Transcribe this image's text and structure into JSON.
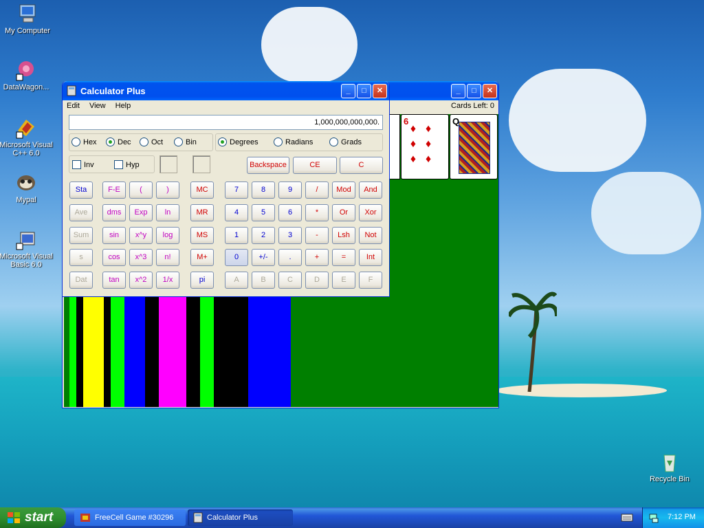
{
  "desktop": {
    "icons": [
      {
        "label": "My Computer",
        "icon": "my-computer-icon"
      },
      {
        "label": "DataWagon...",
        "icon": "datawagon-icon"
      },
      {
        "label": "Microsoft Visual C++ 6.0",
        "icon": "visual-cpp-icon"
      },
      {
        "label": "Mypal",
        "icon": "mypal-icon"
      },
      {
        "label": "Microsoft Visual Basic 6.0",
        "icon": "visual-basic-icon"
      },
      {
        "label": "Recycle Bin",
        "icon": "recycle-bin-icon"
      }
    ]
  },
  "freecell": {
    "cards_left": "Cards Left: 0",
    "cards": [
      {
        "rank": "6",
        "suit": "♦"
      },
      {
        "rank": "Q",
        "suit": "♣"
      }
    ]
  },
  "calculator": {
    "title": "Calculator Plus",
    "menu": [
      "Edit",
      "View",
      "Help"
    ],
    "display": "1,000,000,000,000.",
    "bases": [
      {
        "label": "Hex",
        "selected": false
      },
      {
        "label": "Dec",
        "selected": true
      },
      {
        "label": "Oct",
        "selected": false
      },
      {
        "label": "Bin",
        "selected": false
      }
    ],
    "angles": [
      {
        "label": "Degrees",
        "selected": true
      },
      {
        "label": "Radians",
        "selected": false
      },
      {
        "label": "Grads",
        "selected": false
      }
    ],
    "checks": [
      {
        "label": "Inv",
        "checked": false
      },
      {
        "label": "Hyp",
        "checked": false
      }
    ],
    "top_buttons": [
      "Backspace",
      "CE",
      "C"
    ],
    "stat_buttons": [
      "Sta",
      "Ave",
      "Sum",
      "s",
      "Dat"
    ],
    "sci_col1": [
      "F-E",
      "dms",
      "sin",
      "cos",
      "tan"
    ],
    "sci_col2": [
      "(",
      "Exp",
      "x^y",
      "x^3",
      "x^2"
    ],
    "sci_col3": [
      ")",
      "ln",
      "log",
      "n!",
      "1/x"
    ],
    "mem_buttons": [
      "MC",
      "MR",
      "MS",
      "M+",
      "pi"
    ],
    "keypad": [
      [
        "7",
        "8",
        "9",
        "/",
        "Mod",
        "And"
      ],
      [
        "4",
        "5",
        "6",
        "*",
        "Or",
        "Xor"
      ],
      [
        "1",
        "2",
        "3",
        "-",
        "Lsh",
        "Not"
      ],
      [
        "0",
        "+/-",
        ".",
        "+",
        "=",
        "Int"
      ],
      [
        "A",
        "B",
        "C",
        "D",
        "E",
        "F"
      ]
    ]
  },
  "taskbar": {
    "start_label": "start",
    "tasks": [
      {
        "label": "FreeCell Game #30296",
        "icon": "freecell-icon"
      },
      {
        "label": "Calculator Plus",
        "icon": "calculator-icon"
      }
    ],
    "clock": "7:12 PM"
  }
}
